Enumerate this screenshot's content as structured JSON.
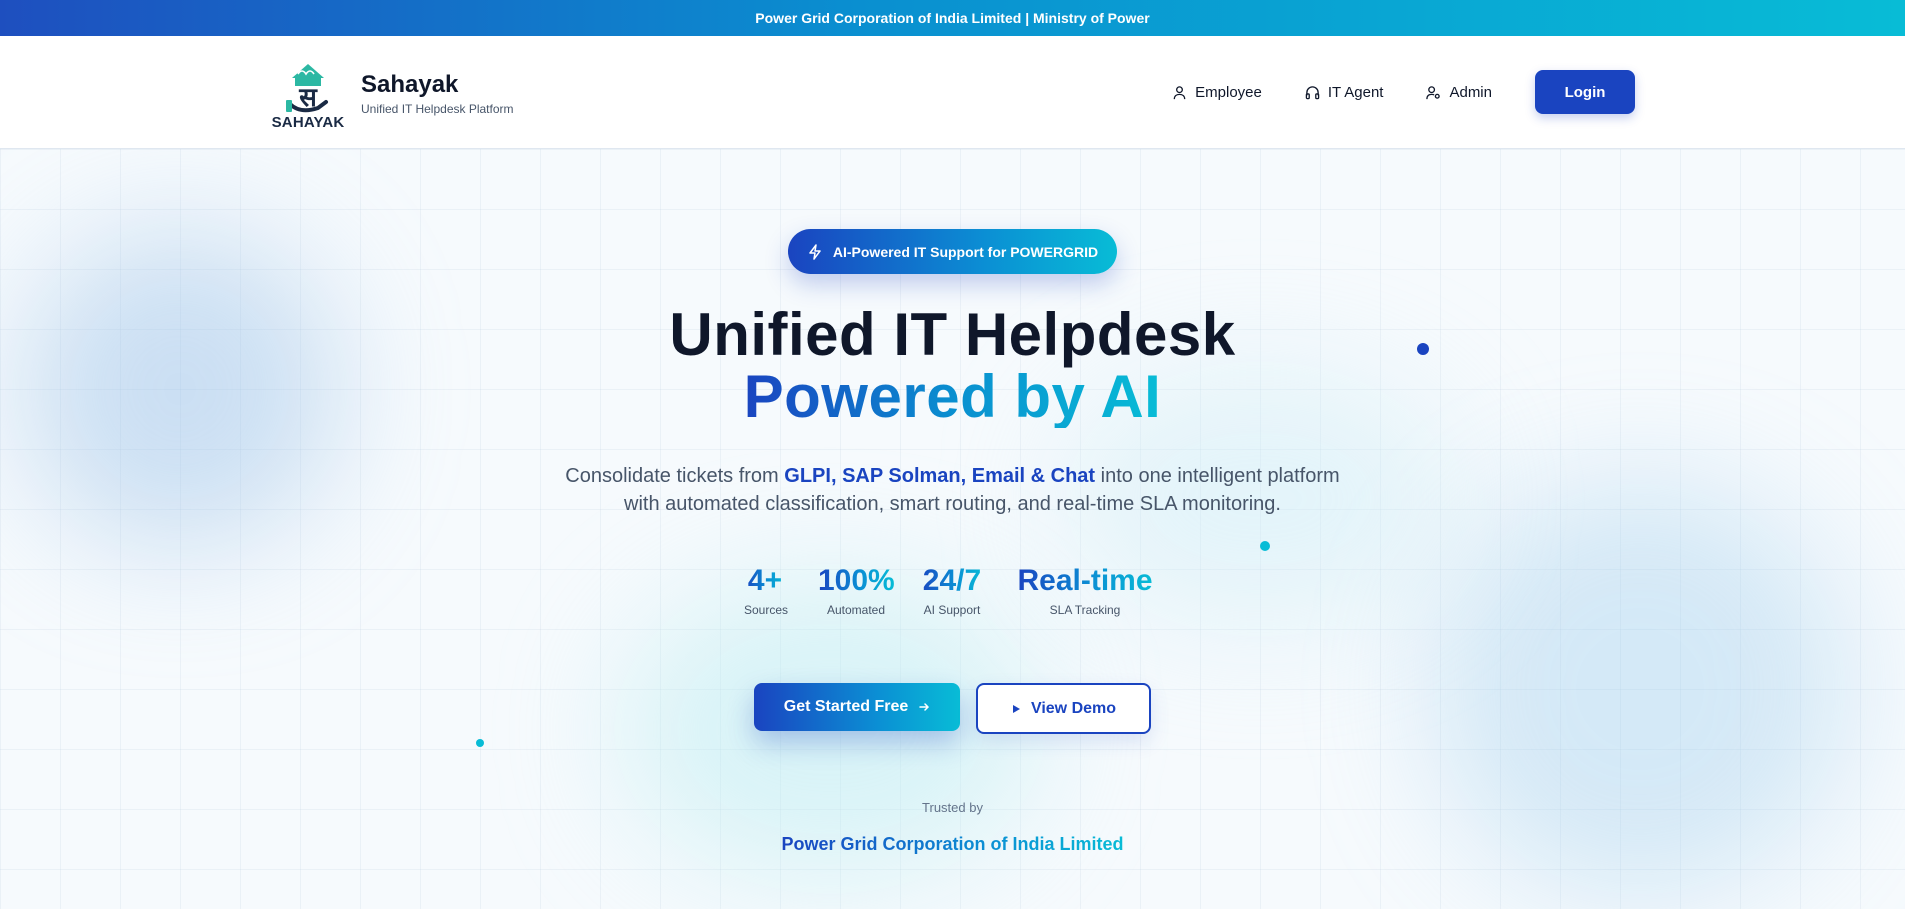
{
  "top_banner": "Power Grid Corporation of India Limited | Ministry of Power",
  "header": {
    "logo_word": "SAHAYAK",
    "brand_title": "Sahayak",
    "brand_subtitle": "Unified IT Helpdesk Platform",
    "nav": [
      {
        "label": "Employee",
        "icon": "user-icon"
      },
      {
        "label": "IT Agent",
        "icon": "headphones-icon"
      },
      {
        "label": "Admin",
        "icon": "admin-icon"
      }
    ],
    "login_label": "Login"
  },
  "hero": {
    "badge": "AI-Powered IT Support for POWERGRID",
    "title_line1": "Unified IT Helpdesk",
    "title_line2": "Powered by AI",
    "desc_prefix": "Consolidate tickets from ",
    "desc_highlight": "GLPI, SAP Solman, Email & Chat",
    "desc_suffix": " into one intelligent platform",
    "desc_line2": "with automated classification, smart routing, and real-time SLA monitoring.",
    "stats": [
      {
        "value": "4+",
        "label": "Sources"
      },
      {
        "value": "100%",
        "label": "Automated"
      },
      {
        "value": "24/7",
        "label": "AI Support"
      },
      {
        "value": "Real-time",
        "label": "SLA Tracking"
      }
    ],
    "cta_primary": "Get Started Free",
    "cta_secondary": "View Demo",
    "trusted_label": "Trusted by",
    "trusted_name": "Power Grid Corporation of India Limited"
  },
  "colors": {
    "primary": "#1a44c0",
    "accent": "#08bcd6",
    "text": "#0f172a",
    "muted": "#475569"
  }
}
